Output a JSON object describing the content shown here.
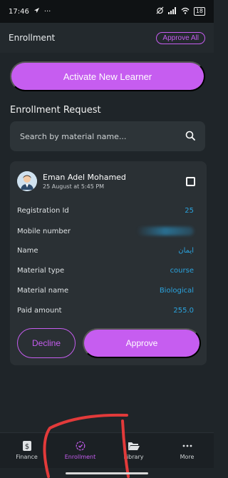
{
  "status_bar": {
    "time": "17:46",
    "battery": "18"
  },
  "app_bar": {
    "title": "Enrollment",
    "approve_all_label": "Approve All"
  },
  "activate_button_label": "Activate New Learner",
  "section_title": "Enrollment Request",
  "search": {
    "placeholder": "Search by material name..."
  },
  "request_card": {
    "name": "Eman Adel Mohamed",
    "date": "25 August at 5:45 PM",
    "details": [
      {
        "label": "Registration Id",
        "value": "25"
      },
      {
        "label": "Mobile number",
        "value": ""
      },
      {
        "label": "Name",
        "value": "ايمان"
      },
      {
        "label": "Material type",
        "value": "course"
      },
      {
        "label": "Material name",
        "value": "Biological"
      },
      {
        "label": "Paid amount",
        "value": "255.0"
      }
    ],
    "decline_label": "Decline",
    "approve_label": "Approve"
  },
  "bottom_nav": {
    "items": [
      {
        "label": "Finance",
        "icon": "dollar-icon"
      },
      {
        "label": "Enrollment",
        "icon": "badge-check-icon"
      },
      {
        "label": "Library",
        "icon": "folder-open-icon"
      },
      {
        "label": "More",
        "icon": "more-dots-icon"
      }
    ]
  },
  "colors": {
    "accent": "#c65df0",
    "value_blue": "#2aa4df",
    "background": "#1f2529"
  }
}
